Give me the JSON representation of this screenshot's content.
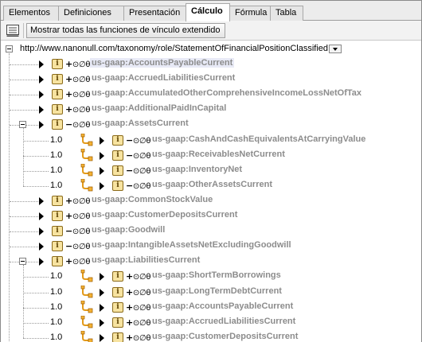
{
  "tabs": [
    {
      "label": "Elementos",
      "active": false
    },
    {
      "label": "Definiciones",
      "active": false
    },
    {
      "label": "Presentación",
      "active": false
    },
    {
      "label": "Cálculo",
      "active": true
    },
    {
      "label": "Fórmula",
      "active": false
    },
    {
      "label": "Tabla",
      "active": false
    }
  ],
  "toolbar": {
    "show_links_label": "Mostrar todas las funciones de vínculo extendido"
  },
  "tree": {
    "root_role": "http://www.nanonull.com/taxonomy/role/StatementOfFinancialPositionClassified",
    "nodes": [
      {
        "name": "us-gaap:AccountsPayableCurrent",
        "balance_sign": "+",
        "weight": "",
        "selected": true
      },
      {
        "name": "us-gaap:AccruedLiabilitiesCurrent",
        "balance_sign": "+",
        "weight": ""
      },
      {
        "name": "us-gaap:AccumulatedOtherComprehensiveIncomeLossNetOfTax",
        "balance_sign": "+",
        "weight": ""
      },
      {
        "name": "us-gaap:AdditionalPaidInCapital",
        "balance_sign": "+",
        "weight": ""
      },
      {
        "name": "us-gaap:AssetsCurrent",
        "balance_sign": "−",
        "weight": "",
        "expanded": true
      },
      {
        "name": "us-gaap:CashAndCashEquivalentsAtCarryingValue",
        "balance_sign": "−",
        "weight": "1.0"
      },
      {
        "name": "us-gaap:ReceivablesNetCurrent",
        "balance_sign": "−",
        "weight": "1.0"
      },
      {
        "name": "us-gaap:InventoryNet",
        "balance_sign": "−",
        "weight": "1.0"
      },
      {
        "name": "us-gaap:OtherAssetsCurrent",
        "balance_sign": "−",
        "weight": "1.0"
      },
      {
        "name": "us-gaap:CommonStockValue",
        "balance_sign": "+",
        "weight": ""
      },
      {
        "name": "us-gaap:CustomerDepositsCurrent",
        "balance_sign": "+",
        "weight": ""
      },
      {
        "name": "us-gaap:Goodwill",
        "balance_sign": "−",
        "weight": ""
      },
      {
        "name": "us-gaap:IntangibleAssetsNetExcludingGoodwill",
        "balance_sign": "−",
        "weight": ""
      },
      {
        "name": "us-gaap:LiabilitiesCurrent",
        "balance_sign": "+",
        "weight": "",
        "expanded": true
      },
      {
        "name": "us-gaap:ShortTermBorrowings",
        "balance_sign": "+",
        "weight": "1.0"
      },
      {
        "name": "us-gaap:LongTermDebtCurrent",
        "balance_sign": "+",
        "weight": "1.0"
      },
      {
        "name": "us-gaap:AccountsPayableCurrent",
        "balance_sign": "+",
        "weight": "1.0"
      },
      {
        "name": "us-gaap:AccruedLiabilitiesCurrent",
        "balance_sign": "+",
        "weight": "1.0"
      },
      {
        "name": "us-gaap:CustomerDepositsCurrent",
        "balance_sign": "+",
        "weight": "1.0"
      }
    ],
    "balance_symbols": "⊙∅θ",
    "info_glyph": "i",
    "icons": {
      "toolbar": "link-list-icon",
      "expand": "collapse-minus-icon",
      "arrow": "play-arrow-icon",
      "info": "info-icon",
      "link": "calculation-link-icon",
      "dropdown": "dropdown-arrow-icon"
    },
    "colors": {
      "concept_text": "#8c8c8c",
      "selected_highlight": "#e8eaf6",
      "info_fill": "#f7e3a0"
    }
  }
}
